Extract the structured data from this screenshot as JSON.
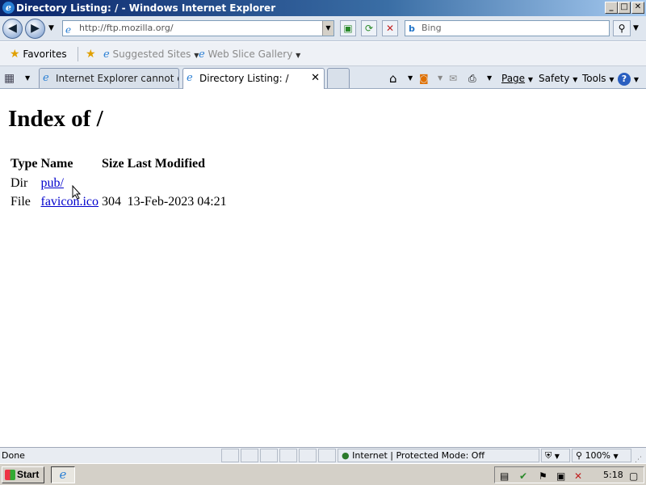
{
  "window": {
    "title": "Directory Listing: / - Windows Internet Explorer",
    "buttons": {
      "minimize": "_",
      "maximize": "□",
      "close": "✕"
    }
  },
  "addressbar": {
    "url": "http://ftp.mozilla.org/",
    "search_placeholder": "Bing"
  },
  "favorites": {
    "label": "Favorites",
    "suggested_sites": "Suggested Sites",
    "web_slice_gallery": "Web Slice Gallery"
  },
  "tabs": [
    {
      "label": "Internet Explorer cannot dis...",
      "active": false
    },
    {
      "label": "Directory Listing: /",
      "active": true
    }
  ],
  "commandbar": {
    "page": "Page",
    "safety": "Safety",
    "tools": "Tools"
  },
  "content": {
    "heading": "Index of /",
    "columns": [
      "Type",
      "Name",
      "Size",
      "Last Modified"
    ],
    "rows": [
      {
        "type": "Dir",
        "name": "pub/",
        "size": "",
        "modified": ""
      },
      {
        "type": "File",
        "name": "favicon.ico",
        "size": "304",
        "modified": "13-Feb-2023 04:21"
      }
    ]
  },
  "statusbar": {
    "status": "Done",
    "zone": "Internet | Protected Mode: Off",
    "zoom": "100%"
  },
  "taskbar": {
    "start": "Start",
    "clock": "5:18"
  }
}
